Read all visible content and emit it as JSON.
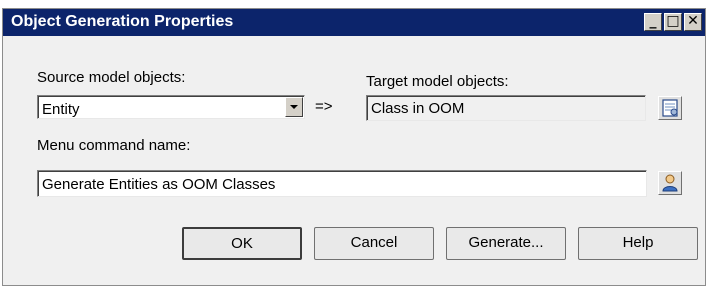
{
  "window": {
    "title": "Object Generation Properties",
    "controls": {
      "minimize": "_",
      "maximize": "□",
      "close": "✕"
    }
  },
  "form": {
    "source_label": "Source model objects:",
    "source_value": "Entity",
    "arrow_text": "=>",
    "target_label": "Target model objects:",
    "target_value": "Class in OOM",
    "menu_label": "Menu command name:",
    "menu_value": "Generate Entities as OOM Classes"
  },
  "buttons": {
    "ok": "OK",
    "cancel": "Cancel",
    "generate": "Generate...",
    "help": "Help"
  }
}
